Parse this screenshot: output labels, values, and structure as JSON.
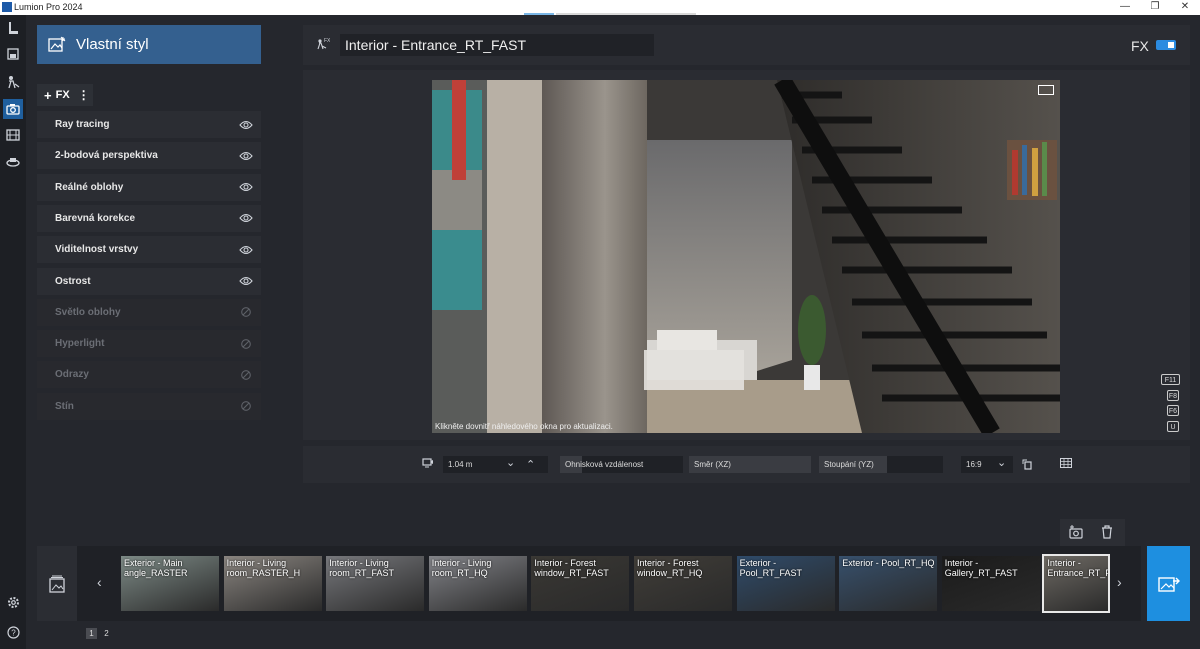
{
  "window": {
    "title": "Lumion Pro 2024",
    "minimize": "—",
    "maximize": "❐",
    "close": "✕"
  },
  "panel": {
    "title": "Vlastní styl",
    "add_fx_label": "FX",
    "add_plus": "+",
    "menu_dots": "⋮"
  },
  "effects": [
    {
      "label": "Ray tracing",
      "enabled": true
    },
    {
      "label": "2-bodová perspektiva",
      "enabled": true
    },
    {
      "label": "Reálné oblohy",
      "enabled": true
    },
    {
      "label": "Barevná korekce",
      "enabled": true
    },
    {
      "label": "Viditelnost vrstvy",
      "enabled": true
    },
    {
      "label": "Ostrost",
      "enabled": true
    },
    {
      "label": "Světlo oblohy",
      "enabled": false
    },
    {
      "label": "Hyperlight",
      "enabled": false
    },
    {
      "label": "Odrazy",
      "enabled": false
    },
    {
      "label": "Stín",
      "enabled": false
    }
  ],
  "header": {
    "scene_name": "Interior - Entrance_RT_FAST",
    "fx_label": "FX",
    "fx_toggle_on": true
  },
  "viewport": {
    "hint": "Klikněte dovnitř náhledového okna pro aktualizaci."
  },
  "shortcuts": [
    "F11",
    "F8",
    "F6",
    "U"
  ],
  "camera": {
    "height_value": "1.04 m",
    "focal_label": "Ohnisková vzdálenost",
    "direction_label": "Směr (XZ)",
    "pitch_label": "Stoupání (YZ)",
    "aspect_value": "16:9",
    "focal_fill": 0.18
  },
  "thumbnails": [
    {
      "label": "Exterior - Main angle_RASTER",
      "color": "#7d8a86"
    },
    {
      "label": "Interior - Living room_RASTER_H",
      "color": "#8a8580"
    },
    {
      "label": "Interior - Living room_RT_FAST",
      "color": "#77787c"
    },
    {
      "label": "Interior - Living room_RT_HQ",
      "color": "#828388"
    },
    {
      "label": "Interior - Forest window_RT_FAST",
      "color": "#3a3834"
    },
    {
      "label": "Interior - Forest window_RT_HQ",
      "color": "#403d38"
    },
    {
      "label": "Exterior - Pool_RT_FAST",
      "color": "#2f4b6a"
    },
    {
      "label": "Exterior - Pool_RT_HQ",
      "color": "#37506c"
    },
    {
      "label": "Interior - Gallery_RT_FAST",
      "color": "#1b1b1b"
    },
    {
      "label": "Interior - Entrance_RT_F",
      "color": "#6e6a64",
      "selected": true
    }
  ],
  "pages": [
    "1",
    "2"
  ]
}
